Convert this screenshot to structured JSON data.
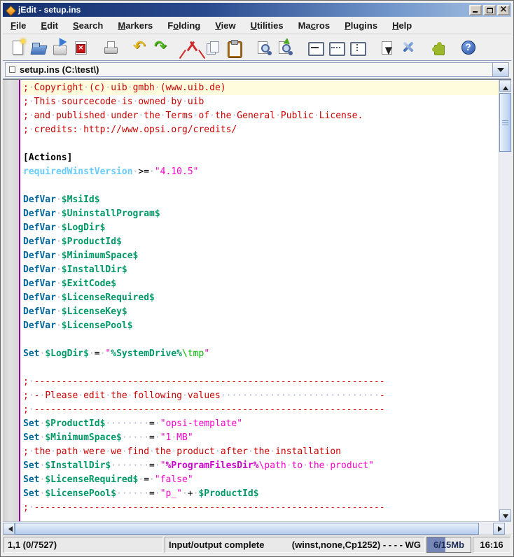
{
  "window": {
    "title": "jEdit - setup.ins"
  },
  "titlebar": {
    "buttons": [
      "minimize",
      "maximize",
      "close"
    ]
  },
  "menubar": {
    "items": [
      {
        "label": "File",
        "mnemonic": "F"
      },
      {
        "label": "Edit",
        "mnemonic": "E"
      },
      {
        "label": "Search",
        "mnemonic": "S"
      },
      {
        "label": "Markers",
        "mnemonic": "M"
      },
      {
        "label": "Folding",
        "mnemonic": "o"
      },
      {
        "label": "View",
        "mnemonic": "V"
      },
      {
        "label": "Utilities",
        "mnemonic": "U"
      },
      {
        "label": "Macros",
        "mnemonic": "c"
      },
      {
        "label": "Plugins",
        "mnemonic": "P"
      },
      {
        "label": "Help",
        "mnemonic": "H"
      }
    ]
  },
  "toolbar": {
    "groups": [
      [
        "new-file",
        "open-file",
        "save-file",
        "close-buffer"
      ],
      [
        "print"
      ],
      [
        "undo",
        "redo"
      ],
      [
        "cut",
        "copy",
        "paste"
      ],
      [
        "find",
        "find-next"
      ],
      [
        "unsplit",
        "split-horizontal",
        "split-vertical"
      ],
      [
        "buffer-options",
        "global-options"
      ],
      [
        "plugin-manager"
      ],
      [
        "help"
      ]
    ]
  },
  "buffer_bar": {
    "dirty_indicator": "clean-square-icon",
    "label": "setup.ins (C:\\test\\)",
    "dropdown_icon": "chevron-down-icon"
  },
  "editor": {
    "current_line_index": 0,
    "whitespace_char": "·",
    "lines": [
      [
        [
          "c",
          "; Copyright (c) uib gmbh (www.uib.de)"
        ]
      ],
      [
        [
          "c",
          "; This sourcecode is owned by uib"
        ]
      ],
      [
        [
          "c",
          "; and published under the Terms of the General Public License."
        ]
      ],
      [
        [
          "c",
          "; credits: http://www.opsi.org/credits/"
        ]
      ],
      [],
      [
        [
          "hd",
          "[Actions]"
        ]
      ],
      [
        [
          "k4",
          "requiredWinstVersion"
        ],
        [
          "op",
          " >= "
        ],
        [
          "l1",
          "\"4.10.5\""
        ]
      ],
      [],
      [
        [
          "k1",
          "DefVar"
        ],
        [
          "op",
          " "
        ],
        [
          "k2",
          "$MsiId$"
        ]
      ],
      [
        [
          "k1",
          "DefVar"
        ],
        [
          "op",
          " "
        ],
        [
          "k2",
          "$UninstallProgram$"
        ]
      ],
      [
        [
          "k1",
          "DefVar"
        ],
        [
          "op",
          " "
        ],
        [
          "k2",
          "$LogDir$"
        ]
      ],
      [
        [
          "k1",
          "DefVar"
        ],
        [
          "op",
          " "
        ],
        [
          "k2",
          "$ProductId$"
        ]
      ],
      [
        [
          "k1",
          "DefVar"
        ],
        [
          "op",
          " "
        ],
        [
          "k2",
          "$MinimumSpace$"
        ]
      ],
      [
        [
          "k1",
          "DefVar"
        ],
        [
          "op",
          " "
        ],
        [
          "k2",
          "$InstallDir$"
        ]
      ],
      [
        [
          "k1",
          "DefVar"
        ],
        [
          "op",
          " "
        ],
        [
          "k2",
          "$ExitCode$"
        ]
      ],
      [
        [
          "k1",
          "DefVar"
        ],
        [
          "op",
          " "
        ],
        [
          "k2",
          "$LicenseRequired$"
        ]
      ],
      [
        [
          "k1",
          "DefVar"
        ],
        [
          "op",
          " "
        ],
        [
          "k2",
          "$LicenseKey$"
        ]
      ],
      [
        [
          "k1",
          "DefVar"
        ],
        [
          "op",
          " "
        ],
        [
          "k2",
          "$LicensePool$"
        ]
      ],
      [],
      [
        [
          "k1",
          "Set"
        ],
        [
          "op",
          " "
        ],
        [
          "k2",
          "$LogDir$"
        ],
        [
          "op",
          " = "
        ],
        [
          "l1",
          "\""
        ],
        [
          "k2",
          "%SystemDrive%"
        ],
        [
          "lb",
          "\\tmp"
        ],
        [
          "l1",
          "\""
        ]
      ],
      [],
      [
        [
          "c",
          "; ----------------------------------------------------------------"
        ]
      ],
      [
        [
          "c",
          "; - Please edit the following values                             -"
        ]
      ],
      [
        [
          "c",
          "; ----------------------------------------------------------------"
        ]
      ],
      [
        [
          "k1",
          "Set"
        ],
        [
          "op",
          " "
        ],
        [
          "k2",
          "$ProductId$"
        ],
        [
          "op",
          "        = "
        ],
        [
          "l1",
          "\"opsi-template\""
        ]
      ],
      [
        [
          "k1",
          "Set"
        ],
        [
          "op",
          " "
        ],
        [
          "k2",
          "$MinimumSpace$"
        ],
        [
          "op",
          "     = "
        ],
        [
          "l1",
          "\"1 MB\""
        ]
      ],
      [
        [
          "c",
          "; the path were we find the product after the installation"
        ]
      ],
      [
        [
          "k1",
          "Set"
        ],
        [
          "op",
          " "
        ],
        [
          "k2",
          "$InstallDir$"
        ],
        [
          "op",
          "       = "
        ],
        [
          "l1",
          "\""
        ],
        [
          "l2",
          "%ProgramFilesDir%"
        ],
        [
          "l1",
          "\\path to the product\""
        ]
      ],
      [
        [
          "k1",
          "Set"
        ],
        [
          "op",
          " "
        ],
        [
          "k2",
          "$LicenseRequired$"
        ],
        [
          "op",
          " = "
        ],
        [
          "l1",
          "\"false\""
        ]
      ],
      [
        [
          "k1",
          "Set"
        ],
        [
          "op",
          " "
        ],
        [
          "k2",
          "$LicensePool$"
        ],
        [
          "op",
          "      = "
        ],
        [
          "l1",
          "\"p_\""
        ],
        [
          "op",
          " + "
        ],
        [
          "k2",
          "$ProductId$"
        ]
      ],
      [
        [
          "c",
          "; ----------------------------------------------------------------"
        ]
      ]
    ]
  },
  "statusbar": {
    "caret_position": "1,1 (0/7527)",
    "message": "Input/output complete",
    "mode_info": "(winst,none,Cp1252)",
    "flags": "- - - - WG",
    "memory": "6/15Mb",
    "memory_fill_percent": 42,
    "clock": "16:16"
  },
  "colors": {
    "current_line_bg": "#fffbdc",
    "gutter_border": "#990099",
    "title_gradient_start": "#15306e",
    "title_gradient_end": "#a9c3e4",
    "tokens": {
      "c": "#cc0000",
      "k1": "#006699",
      "k2": "#009966",
      "k4": "#66ccff",
      "l1": "#ff00cc",
      "l2": "#cc00cc",
      "lb": "#02b902",
      "op": "#000000",
      "hd": "#000000",
      "ws": "#aab4cc"
    }
  }
}
